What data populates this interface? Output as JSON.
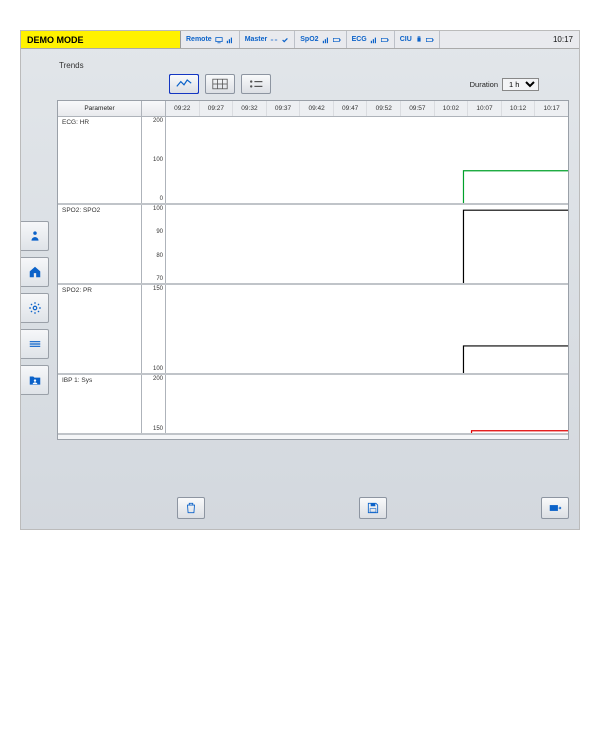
{
  "topbar": {
    "demo_label": "DEMO MODE",
    "segments": [
      {
        "label": "Remote"
      },
      {
        "label": "Master"
      },
      {
        "label": "SpO2"
      },
      {
        "label": "ECG"
      },
      {
        "label": "CIU"
      }
    ],
    "clock": "10:17"
  },
  "sidebar": {
    "items": [
      "patient",
      "home",
      "settings",
      "trends",
      "records"
    ]
  },
  "title": "Trends",
  "toolbar": {
    "view_modes": [
      "graph",
      "table",
      "list"
    ],
    "selected_mode_index": 0,
    "duration_label": "Duration",
    "duration_value": "1 h",
    "duration_options": [
      "1 h"
    ]
  },
  "time_axis": [
    "09:22",
    "09:27",
    "09:32",
    "09:37",
    "09:42",
    "09:47",
    "09:52",
    "09:57",
    "10:02",
    "10:07",
    "10:12",
    "10:17"
  ],
  "param_header": "Parameter",
  "chart_data": [
    {
      "type": "line",
      "parameter": "ECG: HR",
      "y_ticks": [
        200,
        100,
        0
      ],
      "ylim": [
        0,
        200
      ],
      "color": "#00a02a",
      "series": [
        {
          "name": "HR",
          "t_start_frac": 0.74,
          "value": 75
        }
      ]
    },
    {
      "type": "line",
      "parameter": "SPO2: SPO2",
      "y_ticks": [
        100,
        90,
        80,
        70
      ],
      "ylim": [
        70,
        100
      ],
      "color": "#000000",
      "series": [
        {
          "name": "SPO2",
          "t_start_frac": 0.74,
          "value": 98
        }
      ]
    },
    {
      "type": "line",
      "parameter": "SPO2: PR",
      "y_ticks": [
        150,
        100
      ],
      "ylim": [
        50,
        180
      ],
      "color": "#000000",
      "series": [
        {
          "name": "PR",
          "t_start_frac": 0.74,
          "value": 90
        }
      ]
    },
    {
      "type": "line",
      "parameter": "IBP 1: Sys",
      "y_ticks": [
        200,
        150
      ],
      "ylim": [
        100,
        230
      ],
      "color": "#e00000",
      "series": [
        {
          "name": "Sys",
          "t_start_frac": 0.76,
          "value": 105
        }
      ]
    }
  ],
  "bottom_buttons": {
    "delete": "delete",
    "save": "save-disk",
    "export": "export"
  }
}
